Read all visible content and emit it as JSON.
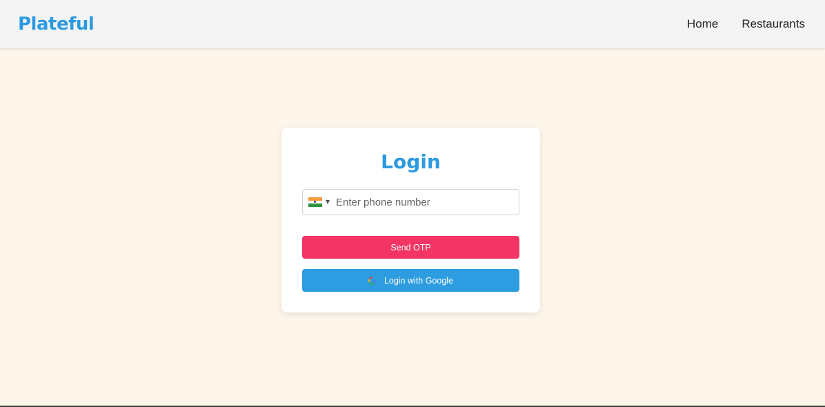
{
  "navbar": {
    "brand": "Plateful",
    "links": [
      {
        "label": "Home"
      },
      {
        "label": "Restaurants"
      }
    ]
  },
  "login": {
    "title": "Login",
    "phone": {
      "country_flag": "india-flag-icon",
      "value": "",
      "placeholder": "Enter phone number"
    },
    "send_otp_label": "Send OTP",
    "google_label": "Login with Google",
    "google_icon": "google-icon"
  },
  "colors": {
    "brand": "#2d9ae0",
    "background": "#fdf5e9",
    "otp_button": "#f23564",
    "google_button": "#2e9ce0"
  }
}
